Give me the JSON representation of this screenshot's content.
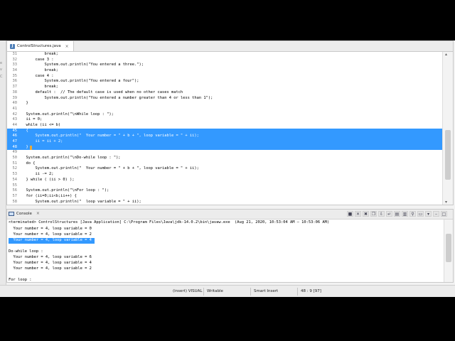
{
  "editor": {
    "tab_label": "ControlStructures.java",
    "code_lines": [
      {
        "num": "31",
        "text": "          break;"
      },
      {
        "num": "32",
        "text": "      case 3 :"
      },
      {
        "num": "33",
        "text": "          System.out.println(\"You entered a three.\");"
      },
      {
        "num": "34",
        "text": "          break;"
      },
      {
        "num": "35",
        "text": "      case 4 :"
      },
      {
        "num": "36",
        "text": "          System.out.println(\"You entered a four\");"
      },
      {
        "num": "37",
        "text": "          break;"
      },
      {
        "num": "38",
        "text": "      default :  // The default case is used when no other cases match"
      },
      {
        "num": "39",
        "text": "          System.out.println(\"You entered a number greater than 4 or less than 1\");"
      },
      {
        "num": "40",
        "text": "  }"
      },
      {
        "num": "41",
        "text": ""
      },
      {
        "num": "42",
        "text": "  System.out.println(\"\\nWhile loop : \");"
      },
      {
        "num": "43",
        "text": "  ii = 0;"
      },
      {
        "num": "44",
        "text": "  while (ii <= b)"
      },
      {
        "num": "45",
        "text": "  {"
      },
      {
        "num": "46",
        "text": "      System.out.println(\"  Your number = \" + b + \", loop variable = \" + ii);"
      },
      {
        "num": "47",
        "text": "      ii = ii + 2;"
      },
      {
        "num": "48",
        "text": "  }"
      },
      {
        "num": "49",
        "text": ""
      },
      {
        "num": "50",
        "text": "  System.out.println(\"\\nDo-while loop : \");"
      },
      {
        "num": "51",
        "text": "  do {"
      },
      {
        "num": "52",
        "text": "      System.out.println(\"  Your number = \" + b + \", loop variable = \" + ii);"
      },
      {
        "num": "53",
        "text": "      ii -= 2;"
      },
      {
        "num": "54",
        "text": "  } while ( (ii > 0) );"
      },
      {
        "num": "55",
        "text": ""
      },
      {
        "num": "56",
        "text": "  System.out.println(\"\\nFor loop : \");"
      },
      {
        "num": "57",
        "text": "  for (ii=0;ii<b;ii++) {"
      },
      {
        "num": "58",
        "text": "      System.out.println(\"  loop variable = \" + ii);"
      }
    ]
  },
  "console": {
    "tab_label": "Console",
    "terminated_line": "<terminated> ControlStructures [Java Application] C:\\Program Files\\Java\\jdk-14.0.2\\bin\\javaw.exe  (Aug 21, 2020, 10:53:04 AM – 10:53:06 AM)",
    "output_lines": [
      {
        "text": "  Your number = 4, loop variable = 0",
        "selected": false
      },
      {
        "text": "  Your number = 4, loop variable = 2",
        "selected": false
      },
      {
        "text": "  Your number = 4, loop variable = 4",
        "selected": true
      },
      {
        "text": "",
        "selected": false
      },
      {
        "text": "Do-while loop :",
        "selected": false
      },
      {
        "text": "  Your number = 4, loop variable = 6",
        "selected": false
      },
      {
        "text": "  Your number = 4, loop variable = 4",
        "selected": false
      },
      {
        "text": "  Your number = 4, loop variable = 2",
        "selected": false
      },
      {
        "text": "",
        "selected": false
      },
      {
        "text": "For loop :",
        "selected": false
      }
    ],
    "toolbar_icons": [
      "stop-icon",
      "remove-launch-icon",
      "remove-all-icon",
      "copy-icon",
      "scroll-lock-icon",
      "word-wrap-icon",
      "show-on-output-icon",
      "show-on-error-icon",
      "pin-icon",
      "display-console-icon",
      "open-console-icon",
      "minimize-icon",
      "maximize-icon"
    ]
  },
  "status_bar": {
    "insert_mode": "(insert) VISUAL",
    "writable": "Writable",
    "insert_type": "Smart Insert",
    "position": "48 : 9 [97]"
  },
  "colors": {
    "selection": "#3399ff",
    "marker": "#e8a93a"
  }
}
